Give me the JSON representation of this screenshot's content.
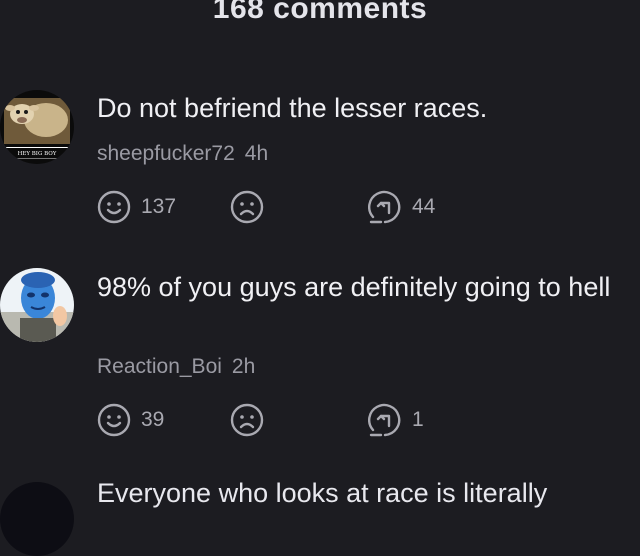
{
  "header": {
    "title": "168 comments"
  },
  "comments": [
    {
      "text": "Do not befriend the lesser races.",
      "author": "sheepfucker72",
      "time": "4h",
      "avatar_caption": "HEY BIG BOY",
      "upvotes": "137",
      "replies": "44"
    },
    {
      "text": "98% of you guys are definitely going to hell",
      "author": "Reaction_Boi",
      "time": "2h",
      "upvotes": "39",
      "replies": "1"
    }
  ],
  "partial_comment": {
    "text": "Everyone who looks at race is literally"
  },
  "colors": {
    "background": "#1c1c21",
    "text": "#f0f0f4",
    "muted": "#9a9aa3",
    "icon": "#a9a9b1"
  },
  "icons": {
    "upvote": "smile-icon",
    "downvote": "frown-icon",
    "reply": "reply-arrow-icon"
  }
}
